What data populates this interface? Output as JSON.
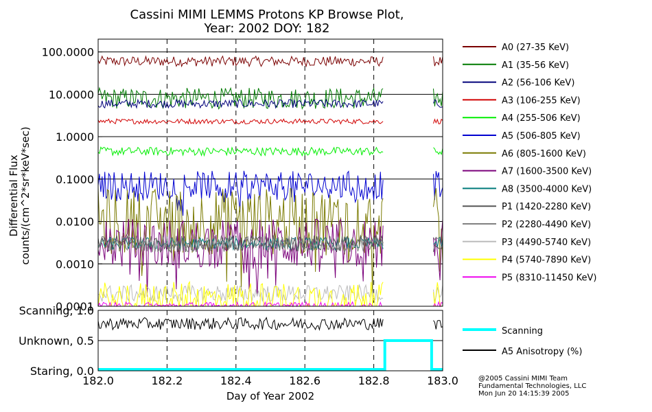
{
  "chart_data": [
    {
      "type": "line",
      "title": "Cassini MIMI LEMMS Protons KP Browse Plot,",
      "subtitle": "Year: 2002 DOY: 182",
      "ylabel_line1": "Differential Flux",
      "ylabel_line2": "counts/(cm^2*sr*keV*sec)",
      "y_scale": "log",
      "xlim": [
        182.0,
        183.0
      ],
      "ylim": [
        0.0001,
        200
      ],
      "y_ticks": [
        {
          "v": 100,
          "label": "100.0000"
        },
        {
          "v": 10,
          "label": "10.0000"
        },
        {
          "v": 1,
          "label": "1.0000"
        },
        {
          "v": 0.1,
          "label": "0.1000"
        },
        {
          "v": 0.01,
          "label": "0.0100"
        },
        {
          "v": 0.001,
          "label": "0.0010"
        },
        {
          "v": 0.0001,
          "label": "0.0001"
        }
      ],
      "grid": true,
      "data_gaps": [
        [
          182.83,
          182.97
        ]
      ],
      "legend_position": "right",
      "series": [
        {
          "name": "A0 (27-35 KeV)",
          "color": "#7a0000",
          "level": 60,
          "spread": 0.12
        },
        {
          "name": "A1 (35-56 KeV)",
          "color": "#007a00",
          "level": 8,
          "spread": 0.25
        },
        {
          "name": "A2 (56-106 KeV)",
          "color": "#00007a",
          "level": 6,
          "spread": 0.1
        },
        {
          "name": "A3 (106-255 KeV)",
          "color": "#d10000",
          "level": 2.3,
          "spread": 0.06
        },
        {
          "name": "A4 (255-506 KeV)",
          "color": "#00ee00",
          "level": 0.45,
          "spread": 0.1
        },
        {
          "name": "A5 (506-805 KeV)",
          "color": "#0000d0",
          "level": 0.07,
          "spread": 0.35
        },
        {
          "name": "A6 (805-1600 KeV)",
          "color": "#7a7a00",
          "level": 0.01,
          "spread": 0.8
        },
        {
          "name": "A7 (1600-3500 KeV)",
          "color": "#7a007a",
          "level": 0.003,
          "spread": 0.6
        },
        {
          "name": "A8 (3500-4000 KeV)",
          "color": "#007a7a",
          "level": 0.003,
          "spread": 0.15
        },
        {
          "name": "P1 (1420-2280 KeV)",
          "color": "#555555",
          "level": 0.003,
          "spread": 0.2
        },
        {
          "name": "P2 (2280-4490 KeV)",
          "color": "#808080",
          "level": 0.003,
          "spread": 0.2
        },
        {
          "name": "P3 (4490-5740 KeV)",
          "color": "#bbbbbb",
          "level": 0.0002,
          "spread": 0.2
        },
        {
          "name": "P4 (5740-7890 KeV)",
          "color": "#ffff00",
          "level": 0.00015,
          "spread": 0.4
        },
        {
          "name": "P5 (8310-11450 KeV)",
          "color": "#ee00ee",
          "level": 0.0001,
          "spread": 0.1
        }
      ]
    },
    {
      "type": "line",
      "xlabel": "Day of Year 2002",
      "xlim": [
        182.0,
        183.0
      ],
      "ylim": [
        0.0,
        1.0
      ],
      "x_ticks": [
        {
          "v": 182.0,
          "label": "182.0"
        },
        {
          "v": 182.2,
          "label": "182.2"
        },
        {
          "v": 182.4,
          "label": "182.4"
        },
        {
          "v": 182.6,
          "label": "182.6"
        },
        {
          "v": 182.8,
          "label": "182.8"
        },
        {
          "v": 183.0,
          "label": "183.0"
        }
      ],
      "y_ticks": [
        {
          "v": 1.0,
          "label": "Scanning, 1.0"
        },
        {
          "v": 0.5,
          "label": "Unknown, 0.5"
        },
        {
          "v": 0.0,
          "label": "Staring, 0.0"
        }
      ],
      "grid": true,
      "series": [
        {
          "name": "Scanning",
          "color": "#00ffff",
          "x": [
            182.0,
            182.832,
            182.832,
            182.968,
            182.968,
            183.0
          ],
          "y": [
            0.0,
            0.0,
            0.5,
            0.5,
            0.0,
            0.0
          ]
        },
        {
          "name": "A5 Anisotropy (%)",
          "color": "#000000",
          "level": 0.78,
          "spread": 0.1
        }
      ]
    }
  ],
  "credit": {
    "line1": "@2005 Cassini MIMI Team",
    "line2": "Fundamental Technologies, LLC",
    "line3": "Mon Jun 20 14:15:39 2005"
  }
}
